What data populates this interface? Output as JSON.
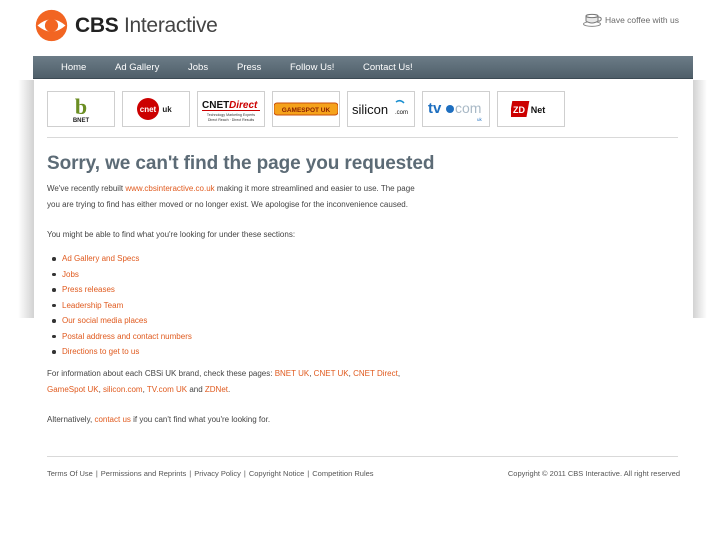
{
  "header": {
    "logo_bold": "CBS",
    "logo_rest": " Interactive",
    "coffee_text": "Have coffee with us"
  },
  "nav": [
    "Home",
    "Ad Gallery",
    "Jobs",
    "Press",
    "Follow Us!",
    "Contact Us!"
  ],
  "brands": {
    "bnet": "BNET",
    "cnet_uk_a": "cnet",
    "cnet_uk_b": "uk",
    "cnet_direct_a": "CNET",
    "cnet_direct_b": "Direct",
    "cnet_direct_tagline": "Technology Marketing Experts",
    "cnet_direct_tagline2": "Direct Reach · Direct Results",
    "gamespot": "GAMESPOT UK",
    "silicon": "silicon",
    "silicon_com": ".com",
    "tvcom_a": "tv",
    "tvcom_b": "com",
    "tvcom_uk": "uk",
    "zdnet_a": "ZD",
    "zdnet_b": "Net"
  },
  "main": {
    "title": "Sorry, we can't find the page you requested",
    "intro_1a": "We've recently rebuilt ",
    "intro_link": "www.cbsinteractive.co.uk",
    "intro_1b": " making it more streamlined and easier to use. The page",
    "intro_2": "you are trying to find has either moved or no longer exist. We apologise for the inconvenience caused.",
    "sections_intro": "You might be able to find what you're looking for under these sections:",
    "sections": [
      "Ad Gallery and Specs",
      "Jobs",
      "Press releases",
      "Leadership Team",
      "Our social media places",
      "Postal address and contact numbers",
      "Directions to get to us"
    ],
    "brand_info_a": "For information about each CBSi UK brand, check these pages: ",
    "brand_links": [
      "BNET UK",
      "CNET UK",
      "CNET Direct",
      "GameSpot UK",
      "silicon.com",
      "TV.com UK",
      "ZDNet"
    ],
    "brand_sep": ", ",
    "brand_and": " and ",
    "brand_end": ".",
    "alt_a": "Alternatively, ",
    "alt_link": "contact us",
    "alt_b": " if you can't find what you're looking for."
  },
  "footer": {
    "links": [
      "Terms Of Use",
      "Permissions and Reprints",
      "Privacy Policy",
      "Copyright Notice",
      "Competition Rules"
    ],
    "pipe": "|",
    "copyright": "Copyright © 2011 CBS Interactive. All right reserved"
  },
  "colors": {
    "link": "#e05a1e",
    "nav_bg": "#5a6a75",
    "title": "#5c6b76",
    "cbs_orange": "#f26522"
  },
  "icons": {
    "logo": "cbs-eye-icon",
    "coffee": "coffee-cup-icon"
  }
}
